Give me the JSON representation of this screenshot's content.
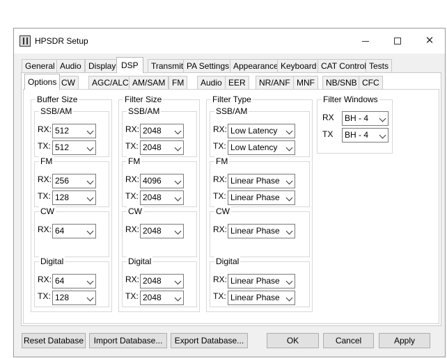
{
  "window": {
    "title": "HPSDR Setup"
  },
  "main_tabs": [
    "General",
    "Audio",
    "Display",
    "DSP",
    "Transmit",
    "PA Settings",
    "Appearance",
    "Keyboard",
    "CAT Control",
    "Tests"
  ],
  "sub_tabs": [
    "Options",
    "CW",
    "AGC/ALC",
    "AM/SAM",
    "FM",
    "Audio",
    "EER",
    "NR/ANF",
    "MNF",
    "NB/SNB",
    "CFC"
  ],
  "buffer_size": {
    "title": "Buffer Size",
    "ssb_am": {
      "title": "SSB/AM",
      "rx_label": "RX:",
      "rx": "512",
      "tx_label": "TX:",
      "tx": "512"
    },
    "fm": {
      "title": "FM",
      "rx_label": "RX:",
      "rx": "256",
      "tx_label": "TX:",
      "tx": "128"
    },
    "cw": {
      "title": "CW",
      "rx_label": "RX:",
      "rx": "64"
    },
    "digital": {
      "title": "Digital",
      "rx_label": "RX:",
      "rx": "64",
      "tx_label": "TX:",
      "tx": "128"
    }
  },
  "filter_size": {
    "title": "Filter Size",
    "ssb_am": {
      "title": "SSB/AM",
      "rx_label": "RX:",
      "rx": "2048",
      "tx_label": "TX:",
      "tx": "2048"
    },
    "fm": {
      "title": "FM",
      "rx_label": "RX:",
      "rx": "4096",
      "tx_label": "TX:",
      "tx": "2048"
    },
    "cw": {
      "title": "CW",
      "rx_label": "RX:",
      "rx": "2048"
    },
    "digital": {
      "title": "Digital",
      "rx_label": "RX:",
      "rx": "2048",
      "tx_label": "TX:",
      "tx": "2048"
    }
  },
  "filter_type": {
    "title": "Filter Type",
    "ssb_am": {
      "title": "SSB/AM",
      "rx_label": "RX:",
      "rx": "Low Latency",
      "tx_label": "TX:",
      "tx": "Low Latency"
    },
    "fm": {
      "title": "FM",
      "rx_label": "RX:",
      "rx": "Linear Phase",
      "tx_label": "TX:",
      "tx": "Linear Phase"
    },
    "cw": {
      "title": "CW",
      "rx_label": "RX:",
      "rx": "Linear Phase"
    },
    "digital": {
      "title": "Digital",
      "rx_label": "RX:",
      "rx": "Linear Phase",
      "tx_label": "TX:",
      "tx": "Linear Phase"
    }
  },
  "filter_windows": {
    "title": "Filter Windows",
    "rx_label": "RX",
    "rx": "BH - 4",
    "tx_label": "TX",
    "tx": "BH - 4"
  },
  "buttons": {
    "reset": "Reset Database",
    "import": "Import Database...",
    "export": "Export Database...",
    "ok": "OK",
    "cancel": "Cancel",
    "apply": "Apply"
  }
}
